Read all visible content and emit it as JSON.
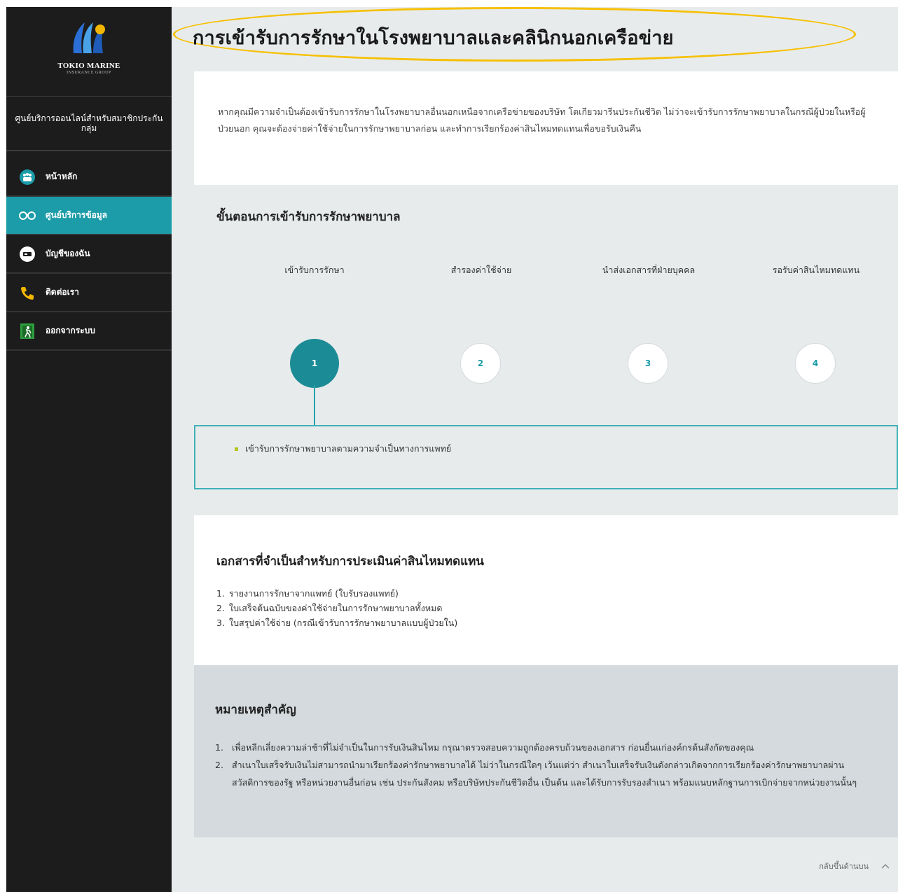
{
  "sidebar": {
    "logo_text": "TOKIO MARINE",
    "logo_sub": "INSURANCE GROUP",
    "portal_title": "ศูนย์บริการออนไลน์สำหรับสมาชิกประกันกลุ่ม",
    "items": [
      {
        "label": "หน้าหลัก",
        "icon": "people-icon",
        "active": false
      },
      {
        "label": "ศูนย์บริการข้อมูล",
        "icon": "glasses-icon",
        "active": true
      },
      {
        "label": "บัญชีของฉัน",
        "icon": "id-card-icon",
        "active": false
      },
      {
        "label": "ติดต่อเรา",
        "icon": "phone-icon",
        "active": false
      },
      {
        "label": "ออกจากระบบ",
        "icon": "exit-icon",
        "active": false
      }
    ]
  },
  "main": {
    "title": "การเข้ารับการรักษาในโรงพยาบาลและคลินิกนอกเครือข่าย",
    "intro": "หากคุณมีความจำเป็นต้องเข้ารับการรักษาในโรงพยาบาลอื่นนอกเหนือจากเครือข่ายของบริษัท โตเกียวมารีนประกันชีวิต ไม่ว่าจะเข้ารับการรักษาพยาบาลในกรณีผู้ป่วยในหรือผู้ป่วยนอก คุณจะต้องจ่ายค่าใช้จ่ายในการรักษาพยาบาลก่อน และทำการเรียกร้องค่าสินไหมทดแทนเพื่อขอรับเงินคืน",
    "steps_heading": "ขั้นตอนการเข้ารับการรักษาพยาบาล",
    "steps": [
      {
        "label": "เข้ารับการรักษา",
        "number": "1"
      },
      {
        "label": "สำรองค่าใช้จ่าย",
        "number": "2"
      },
      {
        "label": "นำส่งเอกสารที่ฝ่ายบุคคล",
        "number": "3"
      },
      {
        "label": "รอรับค่าสินไหมทดแทน",
        "number": "4"
      }
    ],
    "active_step": 1,
    "step_detail": "เข้ารับการรักษาพยาบาลตามความจำเป็นทางการแพทย์",
    "docs_heading": "เอกสารที่จำเป็นสำหรับการประเมินค่าสินไหมทดแทน",
    "docs": [
      "รายงานการรักษาจากแพทย์ (ใบรับรองแพทย์)",
      "ใบเสร็จต้นฉบับของค่าใช้จ่ายในการรักษาพยาบาลทั้งหมด",
      "ใบสรุปค่าใช้จ่าย (กรณีเข้ารับการรักษาพยาบาลแบบผู้ป่วยใน)"
    ],
    "notes_heading": "หมายเหตุสำคัญ",
    "notes": [
      "เพื่อหลีกเลี่ยงความล่าช้าที่ไม่จำเป็นในการรับเงินสินไหม กรุณาตรวจสอบความถูกต้องครบถ้วนของเอกสาร ก่อนยื่นแก่องค์กรต้นสังกัดของคุณ",
      "สำเนาใบเสร็จรับเงินไม่สามารถนำมาเรียกร้องค่ารักษาพยาบาลได้ ไม่ว่าในกรณีใดๆ เว้นแต่ว่า สำเนาใบเสร็จรับเงินดังกล่าวเกิดจากการเรียกร้องค่ารักษาพยาบาลผ่านสวัสดิการของรัฐ หรือหน่วยงานอื่นก่อน เช่น ประกันสังคม หรือบริษัทประกันชีวิตอื่น เป็นต้น และได้รับการรับรองสำเนา พร้อมแนบหลักฐานการเบิกจ่ายจากหน่วยงานนั้นๆ"
    ],
    "back_to_top": "กลับขึ้นด้านบน"
  },
  "colors": {
    "accent": "#1b9ca8",
    "highlight": "#f6c000",
    "sidebar_bg": "#1c1c1c"
  }
}
